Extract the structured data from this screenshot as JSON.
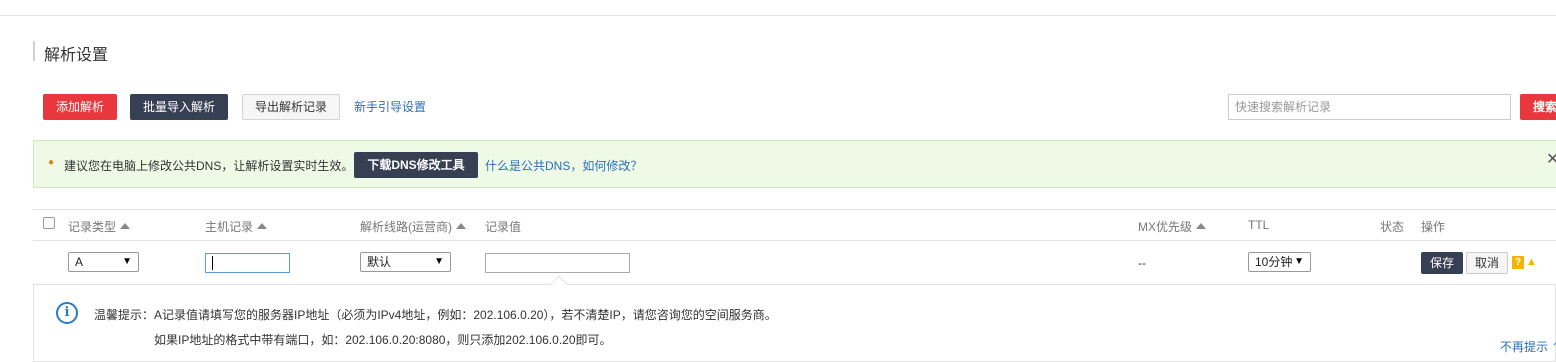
{
  "page": {
    "title": "解析设置"
  },
  "toolbar": {
    "add_label": "添加解析",
    "batch_import_label": "批量导入解析",
    "export_label": "导出解析记录",
    "guide_link": "新手引导设置",
    "search_placeholder": "快速搜索解析记录",
    "search_label": "搜索"
  },
  "notice": {
    "text": "建议您在电脑上修改公共DNS，让解析设置实时生效。",
    "button_label": "下载DNS修改工具",
    "link_text": "什么是公共DNS，如何修改？",
    "close_glyph": "✕"
  },
  "table": {
    "headers": {
      "record_type": "记录类型",
      "host": "主机记录",
      "line": "解析线路(运营商)",
      "value": "记录值",
      "mx": "MX优先级",
      "ttl": "TTL",
      "status": "状态",
      "action": "操作"
    },
    "edit_row": {
      "record_type": "A",
      "host": "",
      "line": "默认",
      "value": "",
      "mx": "--",
      "ttl": "10分钟",
      "save_label": "保存",
      "cancel_label": "取消"
    }
  },
  "tip": {
    "line1": "温馨提示：A记录值请填写您的服务器IP地址（必须为IPv4地址，例如：202.106.0.20），若不清楚IP，请您咨询您的空间服务商。",
    "line2": "如果IP地址的格式中带有端口，如：202.106.0.20:8080，则只添加202.106.0.20即可。",
    "dismiss_label": "不再提示 ⌃"
  },
  "colors": {
    "primary_red": "#e8383d",
    "dark_button": "#373f52",
    "link_blue": "#2b6fb6",
    "notice_bg": "#effae6",
    "warning_yellow": "#f5b400"
  },
  "icons": [
    "sort-up-icon",
    "dropdown-arrow-icon",
    "help-icon",
    "warning-icon",
    "info-icon",
    "close-icon",
    "chevron-up-icon"
  ]
}
